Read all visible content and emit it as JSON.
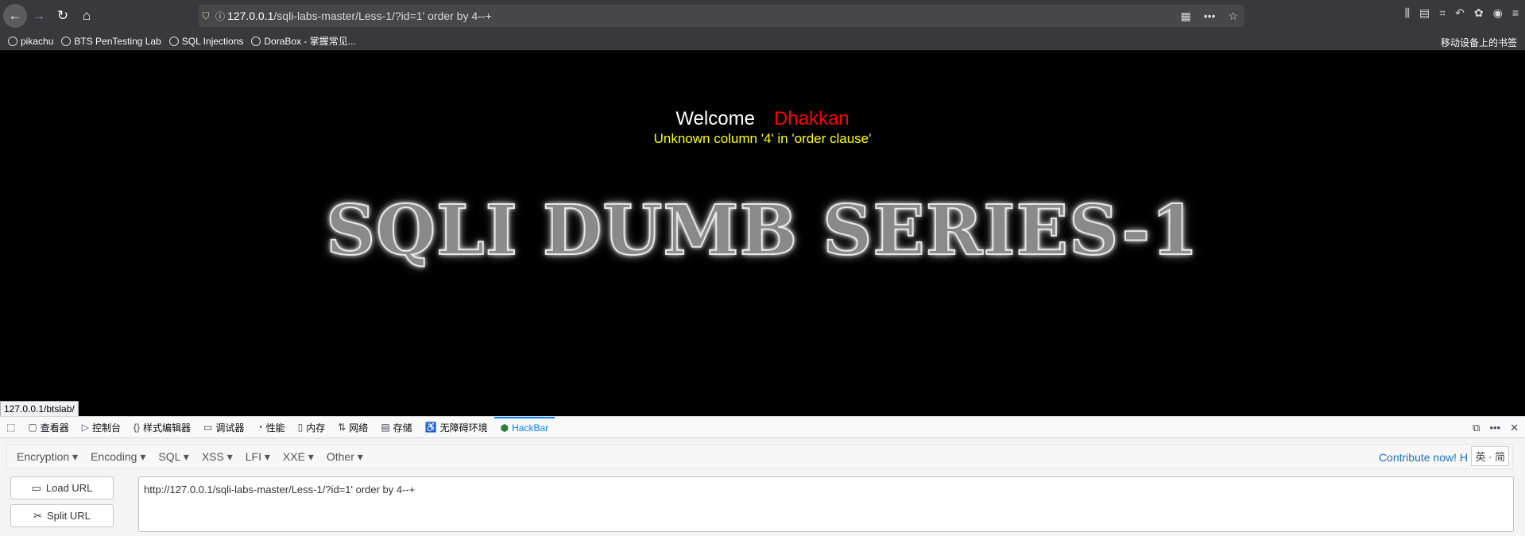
{
  "browser": {
    "url_host": "127.0.0.1",
    "url_rest": "/sqli-labs-master/Less-1/?id=1' order by 4--+",
    "bookmarks": [
      {
        "label": "pikachu"
      },
      {
        "label": "BTS PenTesting Lab"
      },
      {
        "label": "SQL Injections"
      },
      {
        "label": "DoraBox - 掌握常见..."
      }
    ],
    "mobile_bookmarks": "移动设备上的书签",
    "status_url": "127.0.0.1/btslab/"
  },
  "page": {
    "welcome": "Welcome",
    "name": "Dhakkan",
    "error": "Unknown column '4' in 'order clause'",
    "logo_text": "SQLI DUMB SERIES-1"
  },
  "devtools": {
    "tabs": [
      {
        "label": "查看器",
        "icon": "inspector-icon"
      },
      {
        "label": "控制台",
        "icon": "console-icon"
      },
      {
        "label": "样式编辑器",
        "icon": "style-editor-icon"
      },
      {
        "label": "调试器",
        "icon": "debugger-icon"
      },
      {
        "label": "性能",
        "icon": "performance-icon"
      },
      {
        "label": "内存",
        "icon": "memory-icon"
      },
      {
        "label": "网络",
        "icon": "network-icon"
      },
      {
        "label": "存储",
        "icon": "storage-icon"
      },
      {
        "label": "无障碍环境",
        "icon": "accessibility-icon"
      },
      {
        "label": "HackBar",
        "icon": "hackbar-icon"
      }
    ]
  },
  "hackbar": {
    "menus": [
      "Encryption",
      "Encoding",
      "SQL",
      "XSS",
      "LFI",
      "XXE",
      "Other"
    ],
    "contribute": "Contribute now! H",
    "ime": "英 · 简",
    "load_url": "Load URL",
    "split_url": "Split URL",
    "url_value": "http://127.0.0.1/sqli-labs-master/Less-1/?id=1' order by 4--+"
  }
}
